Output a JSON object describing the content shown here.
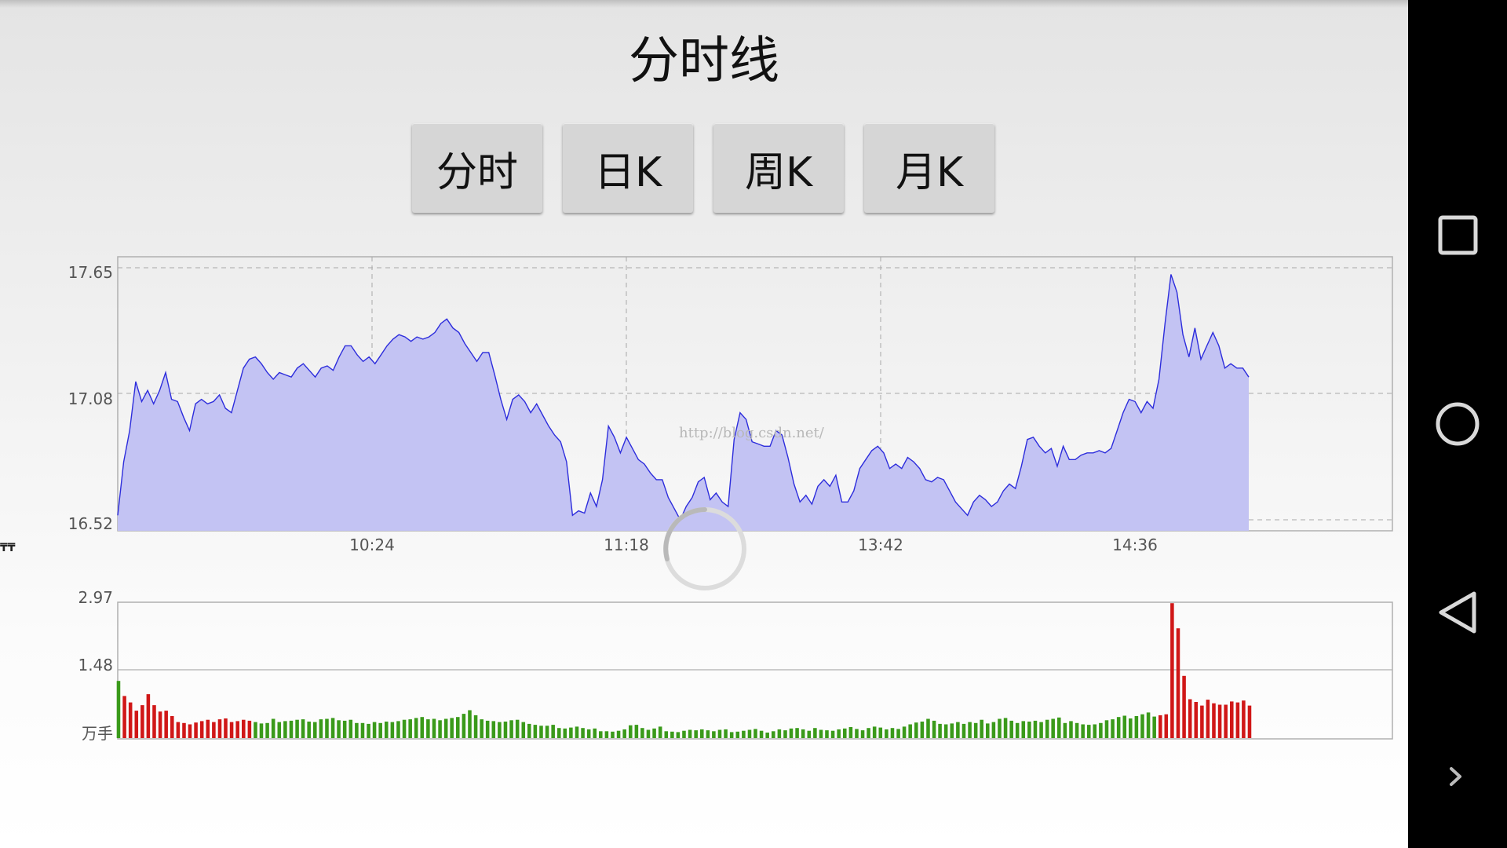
{
  "page_title": "分时线",
  "tabs": [
    {
      "label": "分时"
    },
    {
      "label": "日K"
    },
    {
      "label": "周K"
    },
    {
      "label": "月K"
    }
  ],
  "watermark": "http://blog.csdn.net/",
  "side_label": "₸₸",
  "chart_data": [
    {
      "type": "area",
      "y_ticks": [
        "17.65",
        "17.08",
        "16.52"
      ],
      "x_ticks": [
        "10:24",
        "11:18",
        "13:42",
        "14:36"
      ],
      "ylim": [
        16.52,
        17.65
      ],
      "grid": true,
      "colors": {
        "line": "#2d2ddc",
        "fill": "#c3c3f3"
      },
      "values": [
        16.54,
        16.78,
        16.92,
        17.14,
        17.05,
        17.1,
        17.04,
        17.1,
        17.18,
        17.06,
        17.05,
        16.98,
        16.92,
        17.04,
        17.06,
        17.04,
        17.05,
        17.08,
        17.02,
        17.0,
        17.1,
        17.2,
        17.24,
        17.25,
        17.22,
        17.18,
        17.15,
        17.18,
        17.17,
        17.16,
        17.2,
        17.22,
        17.19,
        17.16,
        17.2,
        17.21,
        17.19,
        17.25,
        17.3,
        17.3,
        17.26,
        17.23,
        17.25,
        17.22,
        17.26,
        17.3,
        17.33,
        17.35,
        17.34,
        17.32,
        17.34,
        17.33,
        17.34,
        17.36,
        17.4,
        17.42,
        17.38,
        17.36,
        17.31,
        17.27,
        17.23,
        17.27,
        17.27,
        17.17,
        17.06,
        16.97,
        17.06,
        17.08,
        17.05,
        17.0,
        17.04,
        16.99,
        16.94,
        16.9,
        16.87,
        16.78,
        16.54,
        16.56,
        16.55,
        16.64,
        16.58,
        16.7,
        16.94,
        16.89,
        16.82,
        16.89,
        16.84,
        16.79,
        16.77,
        16.73,
        16.7,
        16.7,
        16.62,
        16.57,
        16.52,
        16.58,
        16.62,
        16.69,
        16.71,
        16.61,
        16.64,
        16.6,
        16.58,
        16.88,
        17.0,
        16.97,
        16.87,
        16.86,
        16.85,
        16.85,
        16.92,
        16.9,
        16.8,
        16.68,
        16.6,
        16.63,
        16.59,
        16.67,
        16.7,
        16.67,
        16.72,
        16.6,
        16.6,
        16.65,
        16.75,
        16.79,
        16.83,
        16.85,
        16.82,
        16.75,
        16.77,
        16.75,
        16.8,
        16.78,
        16.75,
        16.7,
        16.69,
        16.71,
        16.7,
        16.65,
        16.6,
        16.57,
        16.54,
        16.6,
        16.63,
        16.61,
        16.58,
        16.6,
        16.65,
        16.68,
        16.66,
        16.76,
        16.88,
        16.89,
        16.85,
        16.82,
        16.84,
        16.76,
        16.85,
        16.79,
        16.79,
        16.81,
        16.82,
        16.82,
        16.83,
        16.82,
        16.84,
        16.92,
        17.0,
        17.06,
        17.05,
        17.0,
        17.05,
        17.02,
        17.15,
        17.4,
        17.62,
        17.54,
        17.35,
        17.25,
        17.38,
        17.24,
        17.3,
        17.36,
        17.3,
        17.2,
        17.22,
        17.2,
        17.2,
        17.16
      ]
    },
    {
      "type": "bar",
      "y_ticks": [
        "2.97",
        "1.48"
      ],
      "y_unit": "万手",
      "ylim": [
        0,
        2.97
      ],
      "colors": {
        "up": "#d01717",
        "down": "#3a9a1a"
      },
      "values": [
        1.25,
        0.92,
        0.78,
        0.6,
        0.72,
        0.96,
        0.72,
        0.58,
        0.6,
        0.48,
        0.35,
        0.33,
        0.3,
        0.34,
        0.37,
        0.4,
        0.35,
        0.41,
        0.43,
        0.35,
        0.37,
        0.4,
        0.38,
        0.35,
        0.32,
        0.33,
        0.42,
        0.35,
        0.37,
        0.38,
        0.4,
        0.41,
        0.36,
        0.35,
        0.41,
        0.42,
        0.44,
        0.39,
        0.38,
        0.4,
        0.33,
        0.33,
        0.31,
        0.35,
        0.33,
        0.36,
        0.35,
        0.37,
        0.4,
        0.41,
        0.44,
        0.46,
        0.41,
        0.42,
        0.39,
        0.42,
        0.44,
        0.46,
        0.53,
        0.61,
        0.5,
        0.41,
        0.38,
        0.37,
        0.35,
        0.36,
        0.39,
        0.4,
        0.35,
        0.31,
        0.29,
        0.27,
        0.27,
        0.29,
        0.22,
        0.21,
        0.23,
        0.25,
        0.22,
        0.19,
        0.21,
        0.15,
        0.15,
        0.14,
        0.16,
        0.19,
        0.28,
        0.29,
        0.22,
        0.18,
        0.21,
        0.25,
        0.15,
        0.14,
        0.13,
        0.16,
        0.18,
        0.17,
        0.19,
        0.17,
        0.15,
        0.18,
        0.19,
        0.13,
        0.14,
        0.16,
        0.18,
        0.2,
        0.16,
        0.12,
        0.15,
        0.19,
        0.17,
        0.21,
        0.22,
        0.19,
        0.16,
        0.22,
        0.18,
        0.17,
        0.16,
        0.19,
        0.21,
        0.24,
        0.2,
        0.17,
        0.22,
        0.25,
        0.23,
        0.19,
        0.22,
        0.2,
        0.25,
        0.3,
        0.34,
        0.36,
        0.42,
        0.38,
        0.31,
        0.3,
        0.32,
        0.35,
        0.31,
        0.35,
        0.33,
        0.4,
        0.32,
        0.35,
        0.42,
        0.44,
        0.38,
        0.33,
        0.37,
        0.36,
        0.38,
        0.35,
        0.4,
        0.42,
        0.45,
        0.33,
        0.37,
        0.33,
        0.3,
        0.29,
        0.3,
        0.33,
        0.39,
        0.41,
        0.46,
        0.49,
        0.43,
        0.48,
        0.52,
        0.56,
        0.47,
        0.5,
        0.52,
        2.95,
        2.4,
        1.36,
        0.85,
        0.79,
        0.71,
        0.84,
        0.76,
        0.73,
        0.73,
        0.8,
        0.78,
        0.82,
        0.71
      ],
      "up": [
        false,
        true,
        true,
        true,
        true,
        true,
        true,
        true,
        true,
        true,
        true,
        true,
        true,
        true,
        true,
        true,
        true,
        true,
        true,
        true,
        true,
        true,
        true,
        false,
        false,
        false,
        false,
        false,
        false,
        false,
        false,
        false,
        false,
        false,
        false,
        false,
        false,
        false,
        false,
        false,
        false,
        false,
        false,
        false,
        false,
        false,
        false,
        false,
        false,
        false,
        false,
        false,
        false,
        false,
        false,
        false,
        false,
        false,
        false,
        false,
        false,
        false,
        false,
        false,
        false,
        false,
        false,
        false,
        false,
        false,
        false,
        false,
        false,
        false,
        false,
        false,
        false,
        false,
        false,
        false,
        false,
        false,
        false,
        false,
        false,
        false,
        false,
        false,
        false,
        false,
        false,
        false,
        false,
        false,
        false,
        false,
        false,
        false,
        false,
        false,
        false,
        false,
        false,
        false,
        false,
        false,
        false,
        false,
        false,
        false,
        false,
        false,
        false,
        false,
        false,
        false,
        false,
        false,
        false,
        false,
        false,
        false,
        false,
        false,
        false,
        false,
        false,
        false,
        false,
        false,
        false,
        false,
        false,
        false,
        false,
        false,
        false,
        false,
        false,
        false,
        false,
        false,
        false,
        false,
        false,
        false,
        false,
        false,
        false,
        false,
        false,
        false,
        false,
        false,
        false,
        false,
        false,
        false,
        false,
        false,
        false,
        false,
        false,
        false,
        false,
        false,
        false,
        false,
        false,
        false,
        false,
        false,
        false,
        false,
        false,
        true,
        true,
        true,
        true,
        true,
        true,
        true,
        true,
        true,
        true,
        true,
        true,
        true,
        true,
        true,
        true,
        true,
        true,
        true,
        true
      ]
    }
  ],
  "nav_icons": {
    "recent": "square-icon",
    "home": "circle-icon",
    "back": "triangle-left-icon",
    "more": "chevron-right-icon"
  }
}
